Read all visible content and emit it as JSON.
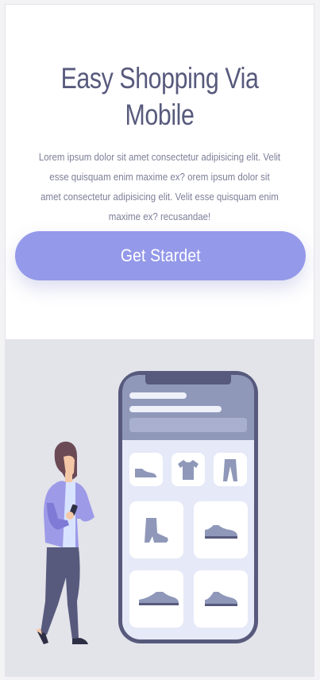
{
  "hero": {
    "title": "Easy Shopping Via Mobile",
    "description": "Lorem ipsum dolor sit amet consectetur adipisicing elit. Velit esse quisquam enim maxime ex? orem ipsum dolor sit amet consectetur adipisicing elit. Velit esse quisquam enim maxime ex? recusandae!",
    "cta_label": "Get Stardet"
  },
  "illustration": {
    "product_icons": [
      "shoe-icon",
      "tshirt-icon",
      "pants-icon",
      "boot-icon",
      "sneaker-icon",
      "sneaker-icon",
      "sneaker-icon"
    ]
  },
  "colors": {
    "title": "#575a7c",
    "body_text": "#7d7f98",
    "cta_background": "#9599e9",
    "illustration_background": "#e3e3ea",
    "phone_frame": "#575a7c",
    "phone_header": "#8f98b9",
    "phone_screen": "#e6e9f7"
  }
}
